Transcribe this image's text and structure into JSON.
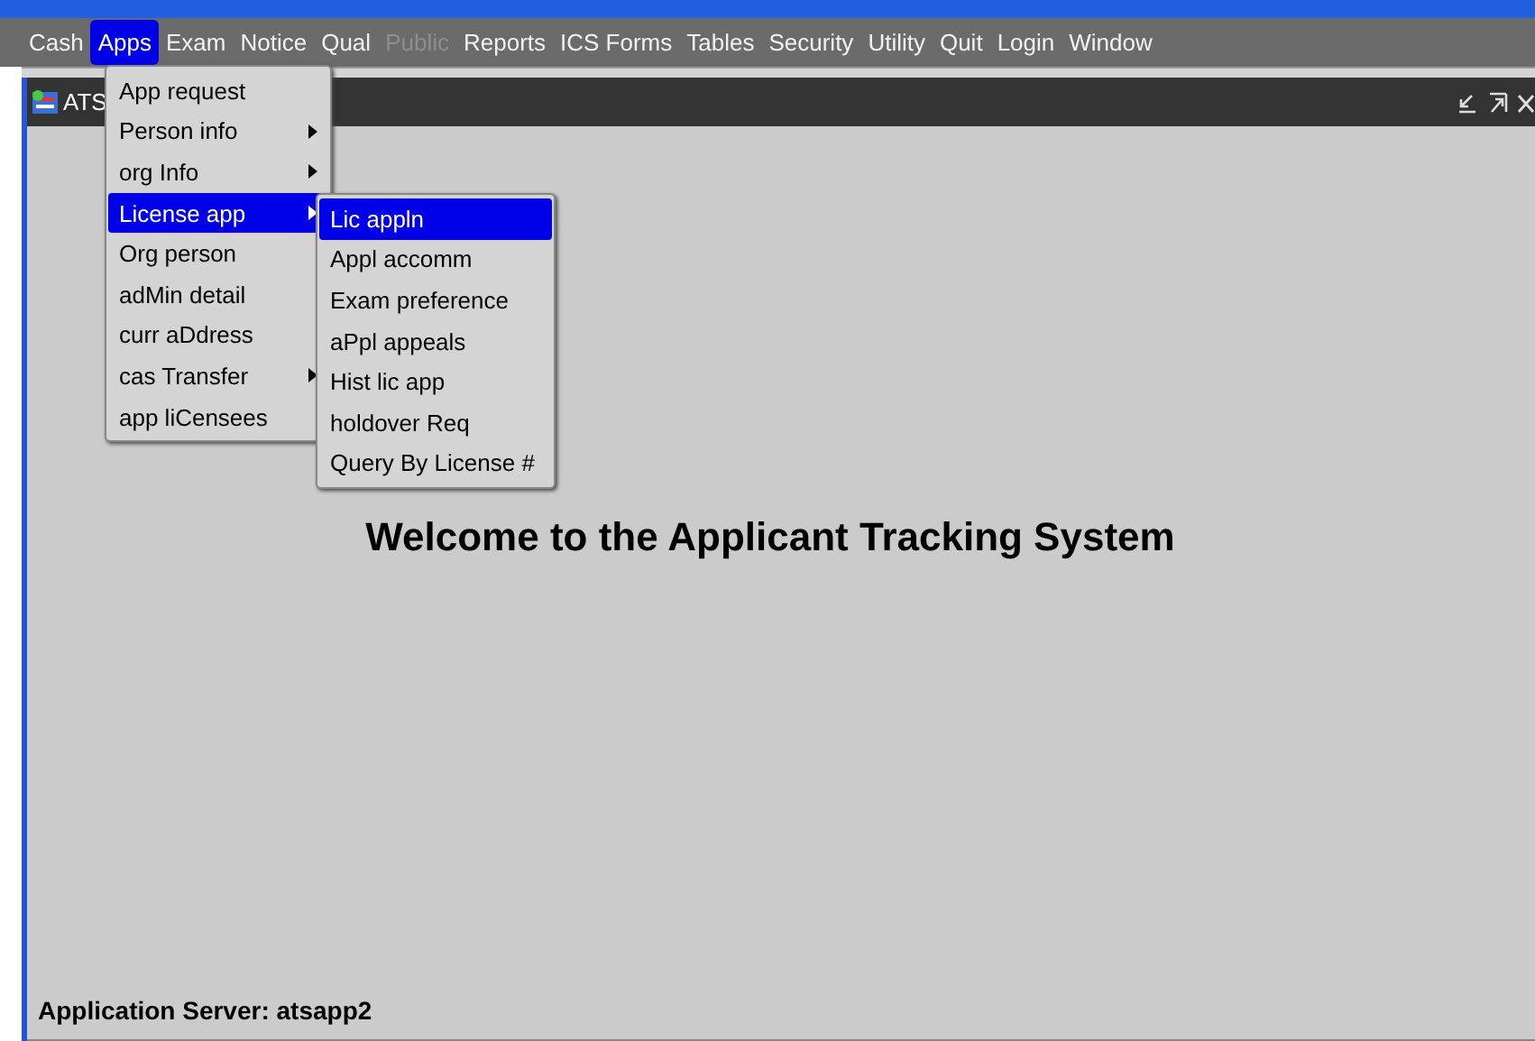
{
  "menu_bar": [
    {
      "label": "Cash",
      "selected": false,
      "disabled": false
    },
    {
      "label": "Apps",
      "selected": true,
      "disabled": false
    },
    {
      "label": "Exam",
      "selected": false,
      "disabled": false
    },
    {
      "label": "Notice",
      "selected": false,
      "disabled": false
    },
    {
      "label": "Qual",
      "selected": false,
      "disabled": false
    },
    {
      "label": "Public",
      "selected": false,
      "disabled": true
    },
    {
      "label": "Reports",
      "selected": false,
      "disabled": false
    },
    {
      "label": "ICS Forms",
      "selected": false,
      "disabled": false
    },
    {
      "label": "Tables",
      "selected": false,
      "disabled": false
    },
    {
      "label": "Security",
      "selected": false,
      "disabled": false
    },
    {
      "label": "Utility",
      "selected": false,
      "disabled": false
    },
    {
      "label": "Quit",
      "selected": false,
      "disabled": false
    },
    {
      "label": "Login",
      "selected": false,
      "disabled": false
    },
    {
      "label": "Window",
      "selected": false,
      "disabled": false
    }
  ],
  "window": {
    "title": "ATS"
  },
  "apps_menu": [
    {
      "label": "App request",
      "submenu": false,
      "selected": false
    },
    {
      "label": "Person info",
      "submenu": true,
      "selected": false
    },
    {
      "label": "org Info",
      "submenu": true,
      "selected": false
    },
    {
      "label": "License app",
      "submenu": true,
      "selected": true
    },
    {
      "label": "Org person",
      "submenu": false,
      "selected": false
    },
    {
      "label": "adMin detail",
      "submenu": false,
      "selected": false
    },
    {
      "label": "curr aDdress",
      "submenu": false,
      "selected": false
    },
    {
      "label": "cas Transfer",
      "submenu": true,
      "selected": false
    },
    {
      "label": "app liCensees",
      "submenu": false,
      "selected": false
    }
  ],
  "license_app_menu": [
    {
      "label": "Lic appln",
      "selected": true
    },
    {
      "label": "Appl accomm",
      "selected": false
    },
    {
      "label": "Exam preference",
      "selected": false
    },
    {
      "label": "aPpl appeals",
      "selected": false
    },
    {
      "label": "Hist lic app",
      "selected": false
    },
    {
      "label": "holdover Req",
      "selected": false
    },
    {
      "label": "Query By License #",
      "selected": false
    }
  ],
  "welcome": "Welcome to the Applicant Tracking System",
  "status": "Application Server: atsapp2"
}
